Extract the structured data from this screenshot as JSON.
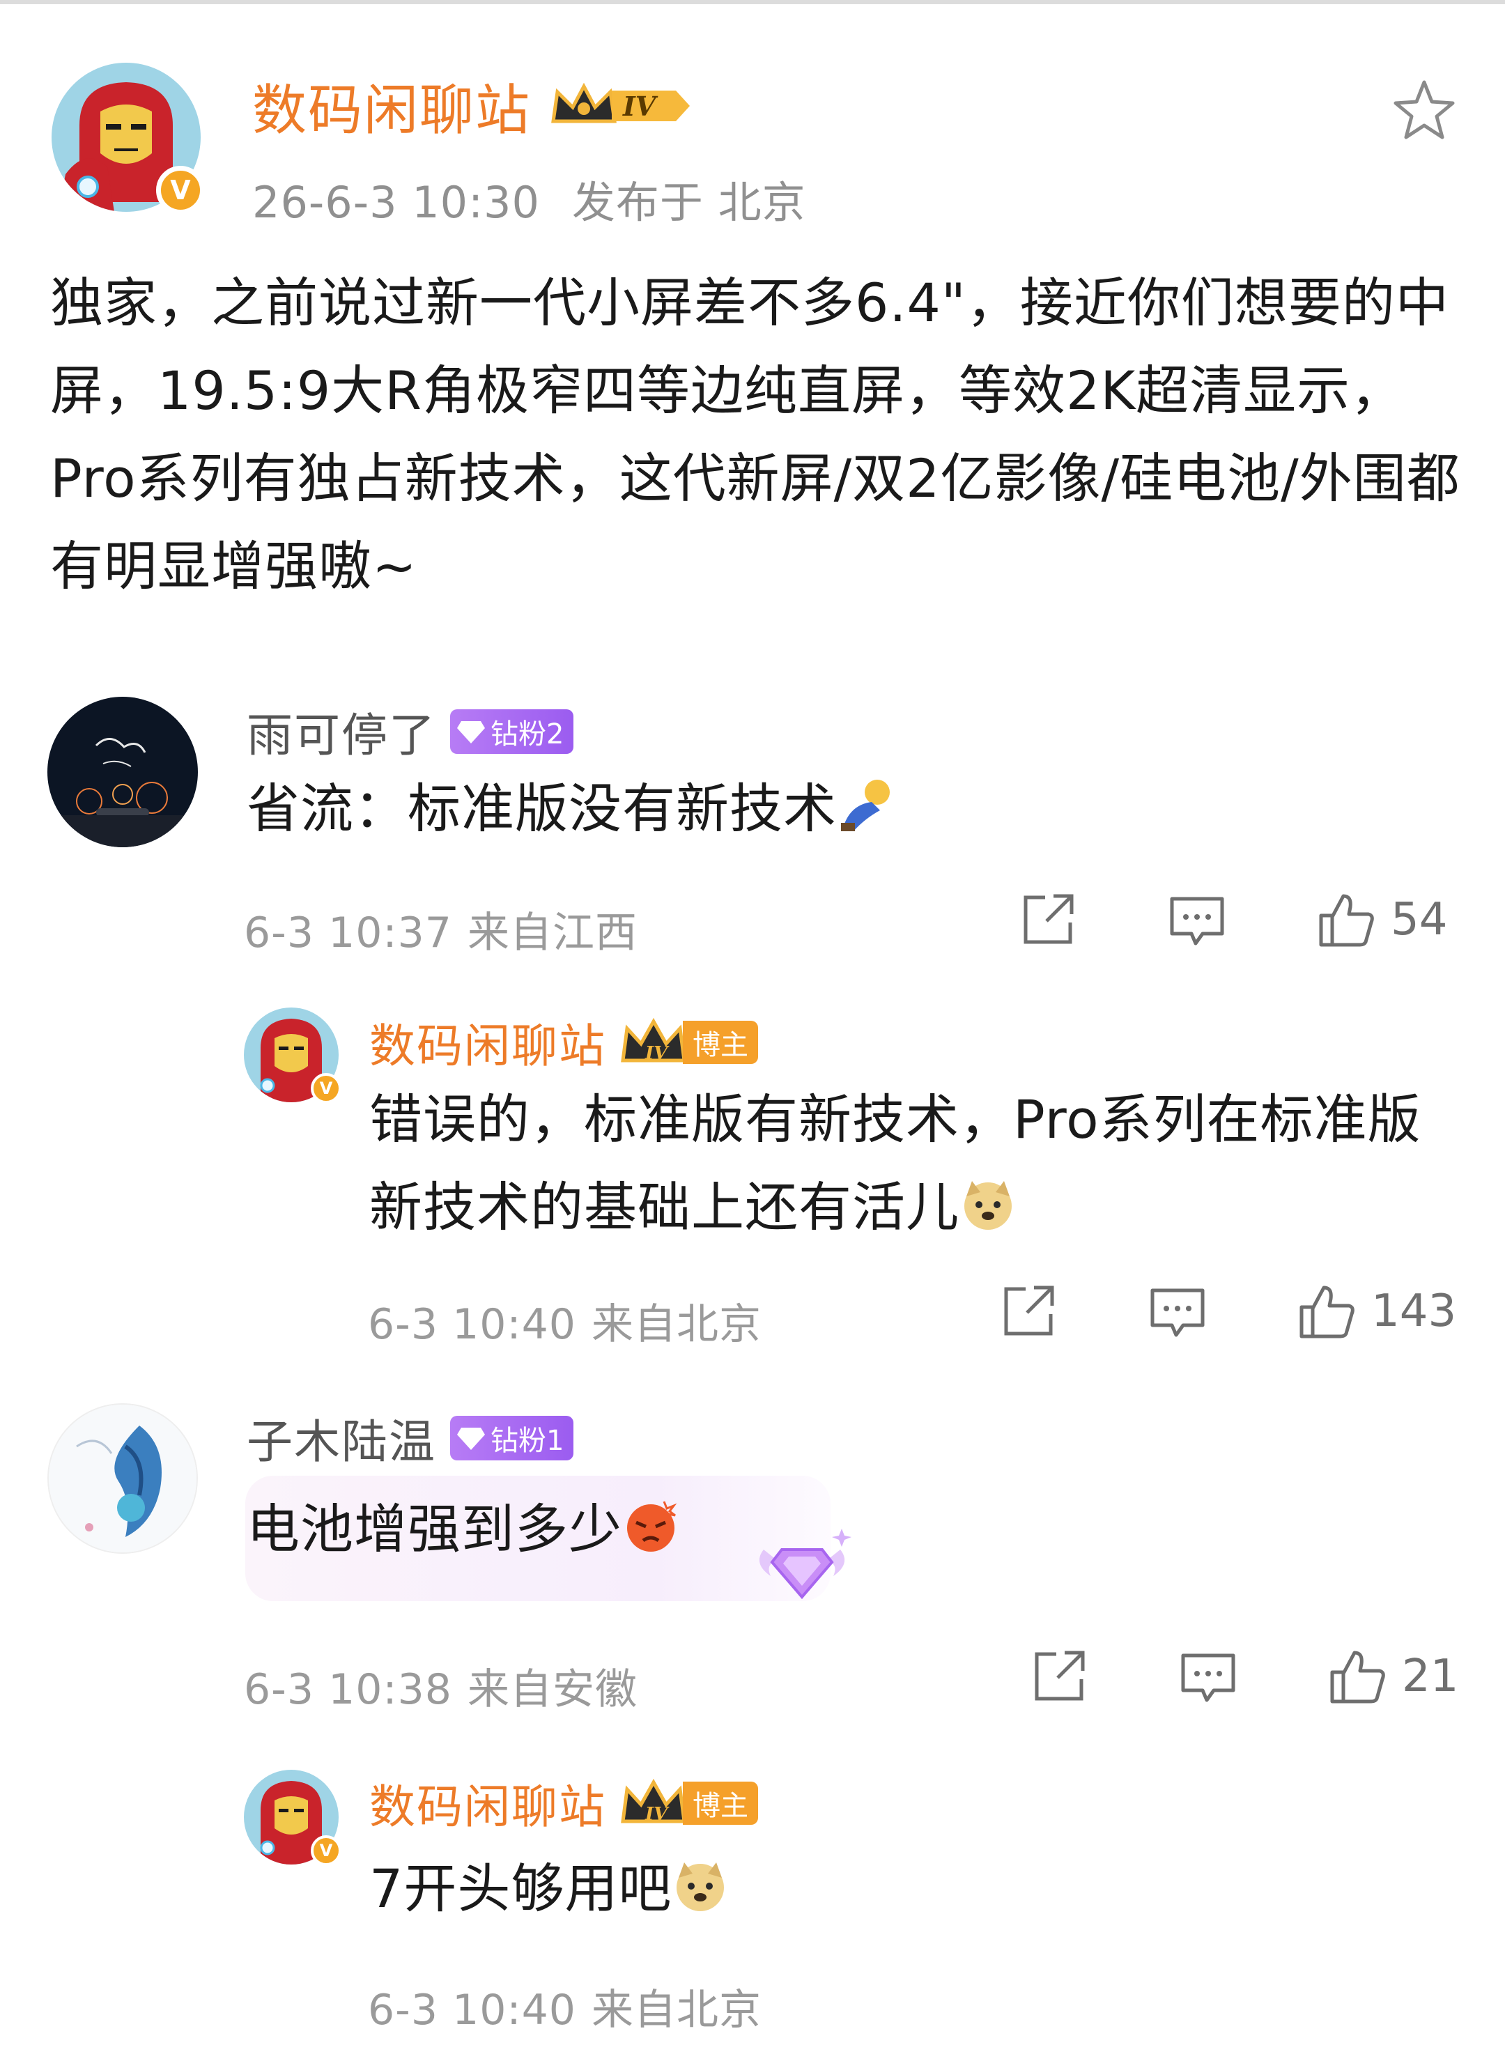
{
  "post": {
    "author": "数码闲聊站",
    "level_badge": "IV",
    "verified_mark": "V",
    "time": "26-6-3 10:30",
    "location": "发布于 北京",
    "content": "独家，之前说过新一代小屏差不多6.4\"，接近你们想要的中屏，19.5:9大R角极窄四等边纯直屏，等效2K超清显示，Pro系列有独占新技术，这代新屏/双2亿影像/硅电池/外围都有明显增强嗷~"
  },
  "comments": [
    {
      "user": "雨可停了",
      "badge": "钻粉2",
      "text": "省流：标准版没有新技术",
      "time": "6-3 10:37",
      "location": "来自江西",
      "likes": "54",
      "reply": {
        "user": "数码闲聊站",
        "host_badge": "博主",
        "level_badge": "IV",
        "text": "错误的，标准版有新技术，Pro系列在标准版新技术的基础上还有活儿",
        "time": "6-3 10:40",
        "location": "来自北京",
        "likes": "143"
      }
    },
    {
      "user": "子木陆温",
      "badge": "钻粉1",
      "text": "电池增强到多少",
      "time": "6-3 10:38",
      "location": "来自安徽",
      "likes": "21",
      "reply": {
        "user": "数码闲聊站",
        "host_badge": "博主",
        "level_badge": "IV",
        "text": "7开头够用吧",
        "time": "6-3 10:40",
        "location": "来自北京"
      }
    }
  ],
  "icons": {
    "favorite": "star-outline-icon",
    "share": "share-icon",
    "comment": "comment-icon",
    "like": "thumbs-up-icon"
  },
  "colors": {
    "author_orange": "#ed7b28",
    "fan_badge_purple": "#a66cf2",
    "host_badge_orange": "#f5a02a",
    "meta_gray": "#909090"
  }
}
